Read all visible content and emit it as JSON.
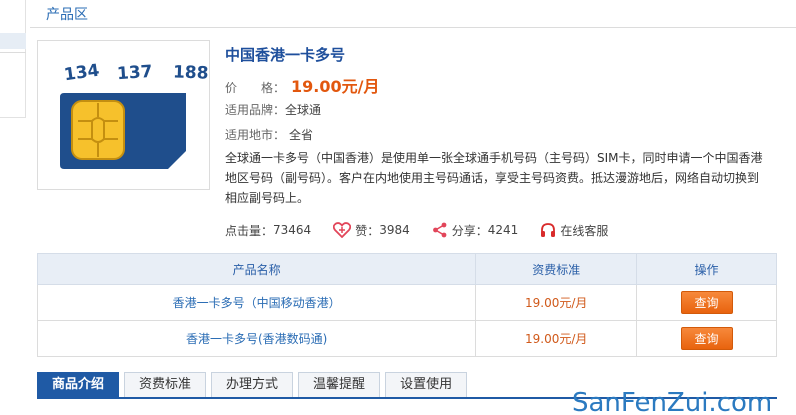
{
  "section_title": "产品区",
  "product": {
    "name": "中国香港一卡多号",
    "price_label": "价　　格：",
    "price_value": "19.00元/月",
    "brand_label": "适用品牌：",
    "brand_value": "全球通",
    "area_label": "适用地市：",
    "area_value": "全省",
    "description": "全球通一卡多号（中国香港）是使用单一张全球通手机号码（主号码）SIM卡，同时申请一个中国香港地区号码（副号码）。客户在内地使用主号码通话，享受主号码资费。抵达漫游地后，网络自动切换到相应副号码上。",
    "sim_numbers": [
      "134",
      "137",
      "188"
    ]
  },
  "stats": {
    "clicks_label": "点击量：",
    "clicks_value": "73464",
    "likes_label": "赞：",
    "likes_value": "3984",
    "share_label": "分享：",
    "share_value": "4241",
    "service_label": "在线客服"
  },
  "table": {
    "headers": [
      "产品名称",
      "资费标准",
      "操作"
    ],
    "rows": [
      {
        "name": "香港一卡多号（中国移动香港）",
        "price": "19.00元/月",
        "action": "查询"
      },
      {
        "name": "香港一卡多号(香港数码通)",
        "price": "19.00元/月",
        "action": "查询"
      }
    ]
  },
  "tabs": [
    "商品介绍",
    "资费标准",
    "办理方式",
    "温馨提醒",
    "设置使用"
  ],
  "watermark": "SanFenZui.com",
  "colors": {
    "accent": "#1f5aa5",
    "price": "#e2570e",
    "button": "#f07a28"
  }
}
